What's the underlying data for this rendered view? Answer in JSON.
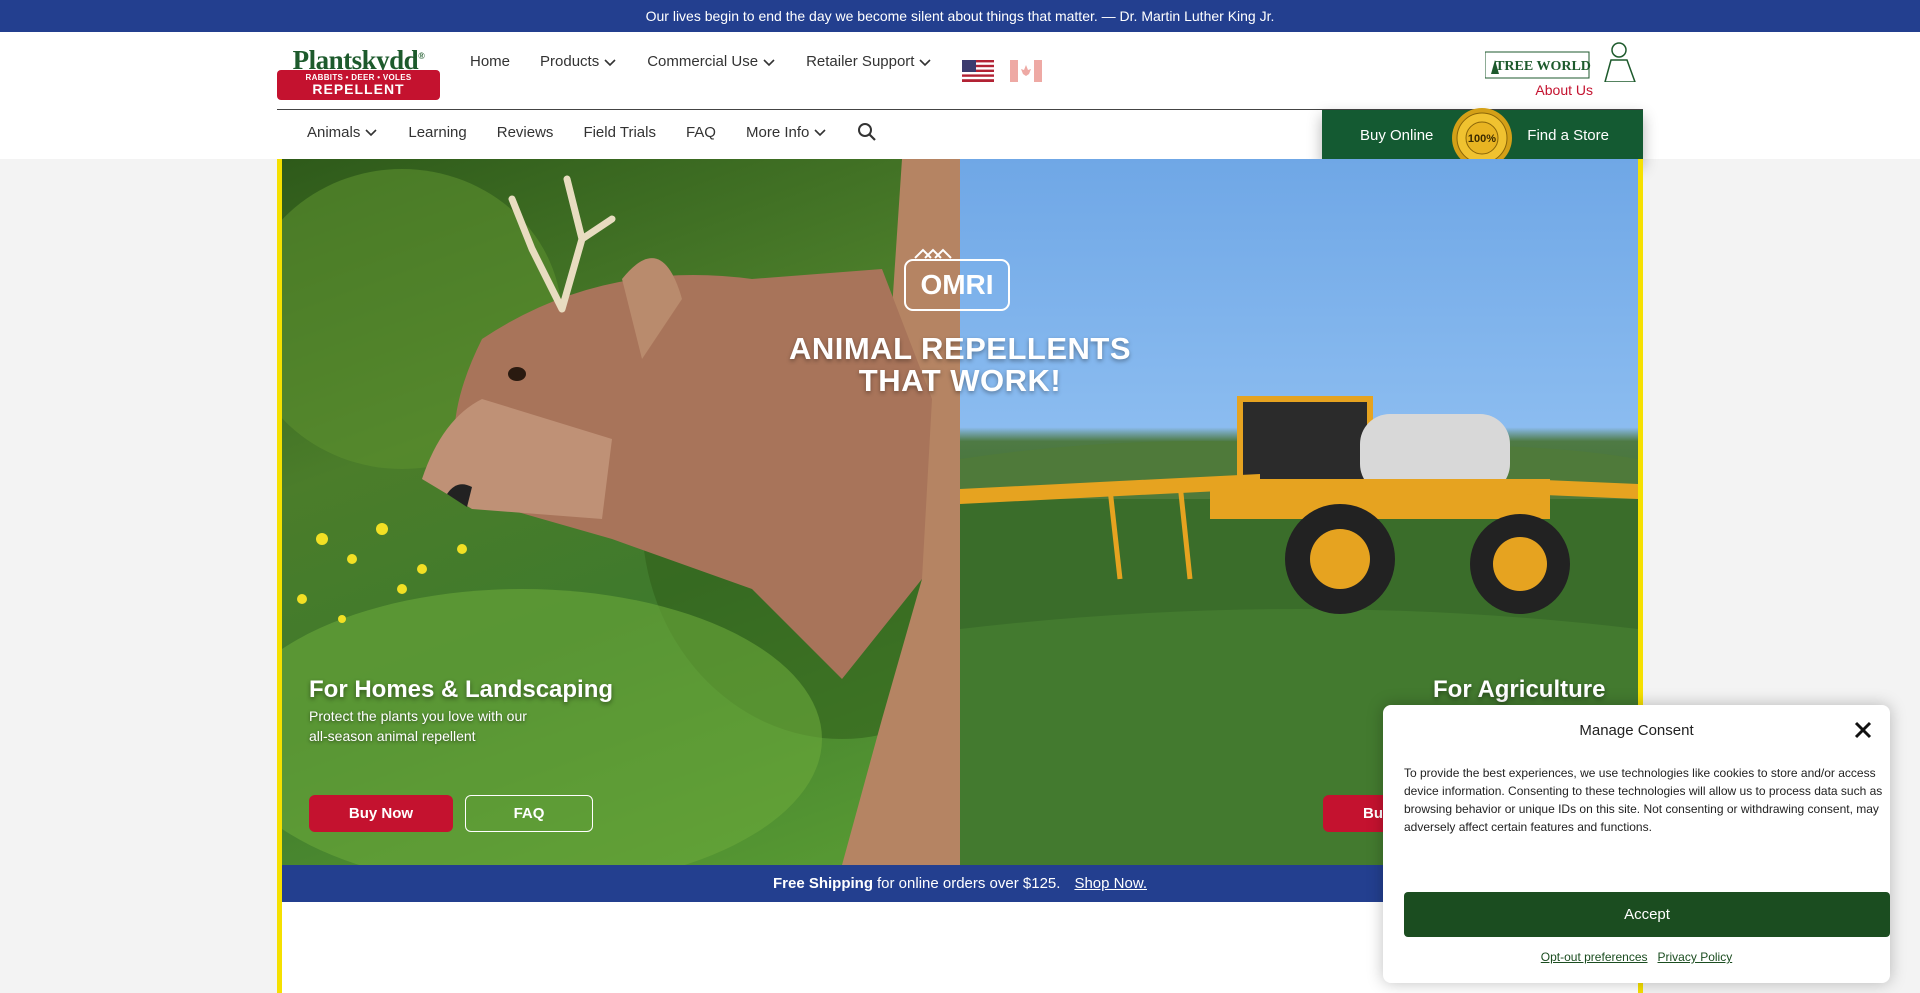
{
  "announcement": "Our lives begin to end the day we become silent about things that matter. — Dr. Martin Luther King Jr.",
  "logo": {
    "name": "Plantskydd",
    "tagline": "RABBITS • DEER • VOLES",
    "badge": "REPELLENT"
  },
  "main_nav": [
    {
      "label": "Home",
      "dropdown": false
    },
    {
      "label": "Products",
      "dropdown": true
    },
    {
      "label": "Commercial Use",
      "dropdown": true
    },
    {
      "label": "Retailer Support",
      "dropdown": true
    }
  ],
  "flags": [
    "us-flag-icon",
    "canada-flag-icon"
  ],
  "tree_world": {
    "brand": "TREE WORLD",
    "about": "About Us"
  },
  "sub_nav": [
    {
      "label": "Animals",
      "dropdown": true
    },
    {
      "label": "Learning",
      "dropdown": false
    },
    {
      "label": "Reviews",
      "dropdown": false
    },
    {
      "label": "Field Trials",
      "dropdown": false
    },
    {
      "label": "FAQ",
      "dropdown": false
    },
    {
      "label": "More Info",
      "dropdown": true
    }
  ],
  "buy_box": {
    "buy_online": "Buy Online",
    "find_store": "Find a Store",
    "seal_text": "100%"
  },
  "hero": {
    "badge": "OMRI",
    "title_line1": "ANIMAL REPELLENTS",
    "title_line2": "THAT WORK!",
    "homes": {
      "title": "For Homes & Landscaping",
      "desc_line1": "Protect the plants you love with our",
      "desc_line2": "all-season animal repellent",
      "buy": "Buy Now",
      "faq": "FAQ"
    },
    "agriculture": {
      "title": "For Agriculture",
      "buy": "Bu"
    }
  },
  "shipping": {
    "bold": "Free Shipping",
    "text": "for online orders over $125.",
    "link": "Shop Now."
  },
  "consent": {
    "title": "Manage Consent",
    "text": "To provide the best experiences, we use technologies like cookies to store and/or access device information. Consenting to these technologies will allow us to process data such as browsing behavior or unique IDs on this site. Not consenting or withdrawing consent, may adversely affect certain features and functions.",
    "accept": "Accept",
    "opt_out": "Opt-out preferences",
    "privacy": "Privacy Policy"
  },
  "colors": {
    "navy": "#233f8f",
    "brand_red": "#c4122f",
    "dark_green": "#145a32",
    "accept_green": "#1b4d20",
    "yellow_border": "#f5e000"
  }
}
